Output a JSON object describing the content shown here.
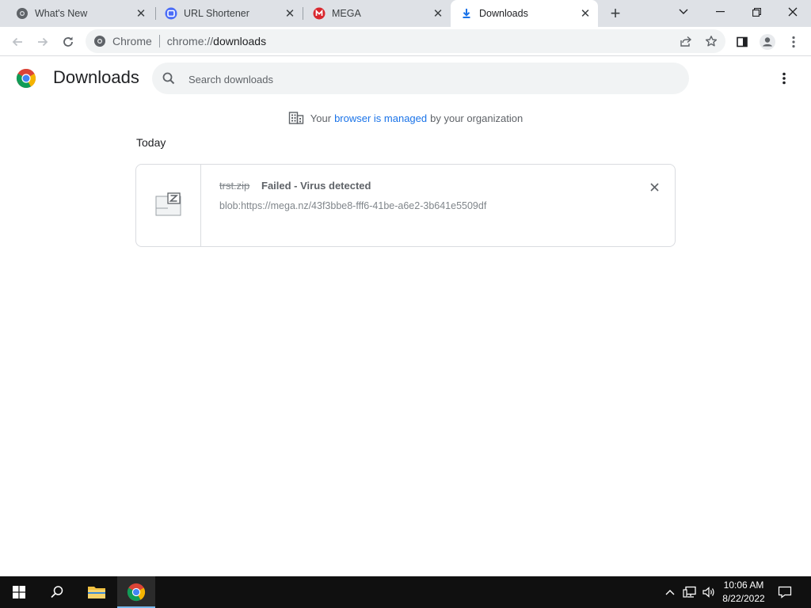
{
  "window": {
    "tabs": [
      {
        "title": "What's New",
        "icon": "chrome-gear-icon",
        "active": false
      },
      {
        "title": "URL Shortener",
        "icon": "url-shortener-icon",
        "active": false
      },
      {
        "title": "MEGA",
        "icon": "mega-icon",
        "active": false
      },
      {
        "title": "Downloads",
        "icon": "download-arrow-icon",
        "active": true
      }
    ]
  },
  "toolbar": {
    "site_label": "Chrome",
    "url_scheme": "chrome://",
    "url_path": "downloads"
  },
  "page": {
    "title": "Downloads",
    "search_placeholder": "Search downloads",
    "managed": {
      "prefix": "Your",
      "link": "browser is managed",
      "suffix": "by your organization"
    },
    "section_date": "Today",
    "downloads": [
      {
        "file_name": "trst.zip",
        "status": "Failed - Virus detected",
        "url": "blob:https://mega.nz/43f3bbe8-fff6-41be-a6e2-3b641e5509df"
      }
    ]
  },
  "taskbar": {
    "time": "10:06 AM",
    "date": "8/22/2022"
  },
  "colors": {
    "accent_link": "#1a73e8",
    "tabstrip_bg": "#dee1e6",
    "taskbar_bg": "#101010"
  }
}
